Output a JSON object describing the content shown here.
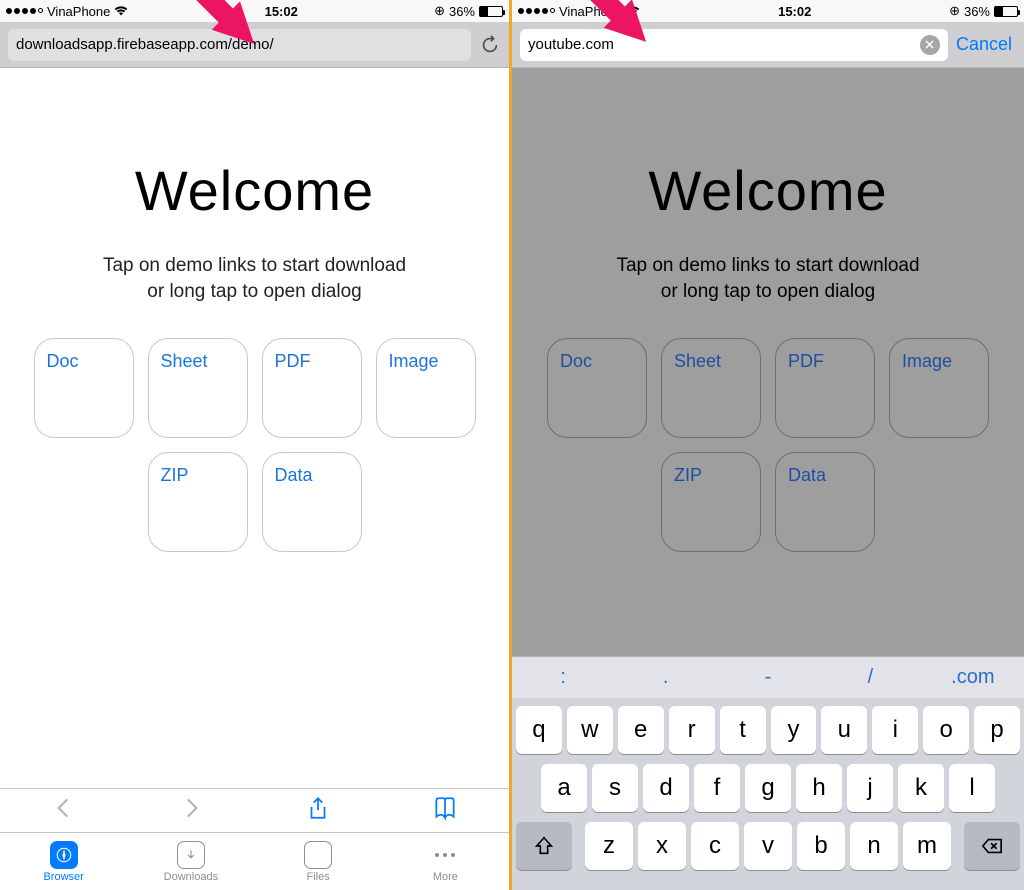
{
  "status": {
    "carrier": "VinaPhone",
    "time": "15:02",
    "battery_pct": "36%"
  },
  "left": {
    "url": "downloadsapp.firebaseapp.com/demo/"
  },
  "right": {
    "url": "youtube.com",
    "cancel": "Cancel"
  },
  "page": {
    "title": "Welcome",
    "subtitle_l1": "Tap on demo links to start download",
    "subtitle_l2": "or long tap to open dialog",
    "tiles": {
      "doc": "Doc",
      "sheet": "Sheet",
      "pdf": "PDF",
      "image": "Image",
      "zip": "ZIP",
      "data": "Data"
    }
  },
  "tabs": {
    "browser": "Browser",
    "downloads": "Downloads",
    "files": "Files",
    "more": "More"
  },
  "keyboard": {
    "accessory": {
      "colon": ":",
      "dot": ".",
      "dash": "-",
      "slash": "/",
      "com": ".com"
    },
    "row1": [
      "q",
      "w",
      "e",
      "r",
      "t",
      "y",
      "u",
      "i",
      "o",
      "p"
    ],
    "row2": [
      "a",
      "s",
      "d",
      "f",
      "g",
      "h",
      "j",
      "k",
      "l"
    ],
    "row3": [
      "z",
      "x",
      "c",
      "v",
      "b",
      "n",
      "m"
    ]
  }
}
